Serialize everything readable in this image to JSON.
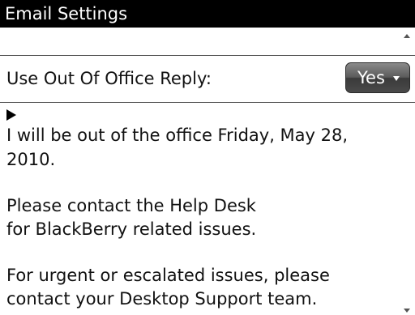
{
  "header": {
    "title": "Email Settings"
  },
  "out_of_office": {
    "label": "Use Out Of Office Reply:",
    "selected_value": "Yes"
  },
  "message": {
    "lines": [
      "I will be out of the office Friday, May 28,",
      "2010.",
      "Please contact the Help Desk",
      "for BlackBerry related issues.",
      "For urgent or escalated issues, please",
      "contact your Desktop Support team."
    ]
  },
  "icons": {
    "cursor": "cursor-marker-icon",
    "dropdown": "chevron-down-icon",
    "scroll_up": "scroll-up-icon",
    "scroll_down": "scroll-down-icon"
  },
  "colors": {
    "title_bar_background": "#000000",
    "title_bar_text": "#ffffff",
    "button_background": "#5b5b5b",
    "text": "#111111"
  }
}
